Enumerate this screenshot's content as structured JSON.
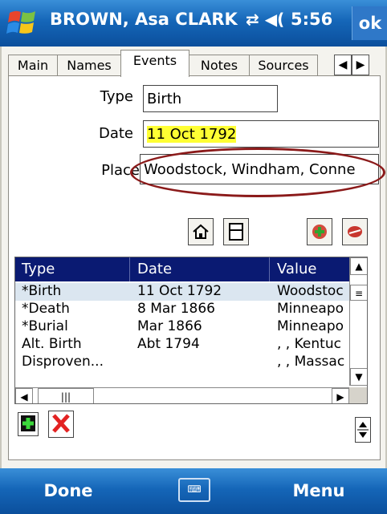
{
  "titlebar": {
    "title": "BROWN, Asa CLARK",
    "status_icons": "⇄ ◀(",
    "time": "5:56",
    "ok_label": "ok"
  },
  "tabs": {
    "main": "Main",
    "names": "Names",
    "events": "Events",
    "notes": "Notes",
    "sources": "Sources",
    "prev_arrow": "◀",
    "next_arrow": "▶"
  },
  "form": {
    "type_label": "Type",
    "type_value": "Birth",
    "date_label": "Date",
    "date_value": "11 Oct 1792",
    "place_label": "Place",
    "place_value": "Woodstock, Windham, Conne"
  },
  "grid": {
    "headers": [
      "Type",
      "Date",
      "Value"
    ],
    "rows": [
      {
        "type": "*Birth",
        "date": "11 Oct 1792",
        "value": "Woodstoc"
      },
      {
        "type": "*Death",
        "date": "8 Mar 1866",
        "value": "Minneapo"
      },
      {
        "type": "*Burial",
        "date": "Mar 1866",
        "value": "Minneapo"
      },
      {
        "type": "Alt. Birth",
        "date": "Abt 1794",
        "value": ", , Kentuc"
      },
      {
        "type": "Disproven...",
        "date": "",
        "value": ", , Massac"
      }
    ]
  },
  "bottombar": {
    "left_softkey": "Done",
    "right_softkey": "Menu"
  },
  "colors": {
    "titlebar": "#1566b8",
    "grid_header": "#0a1a72",
    "highlight": "#ffff33",
    "annotation_ellipse": "#8b1a1a"
  },
  "icons": [
    "windows-flag-icon",
    "home-icon",
    "document-icon",
    "add-event-icon",
    "remove-event-icon",
    "add-icon",
    "delete-icon",
    "keyboard-icon"
  ]
}
